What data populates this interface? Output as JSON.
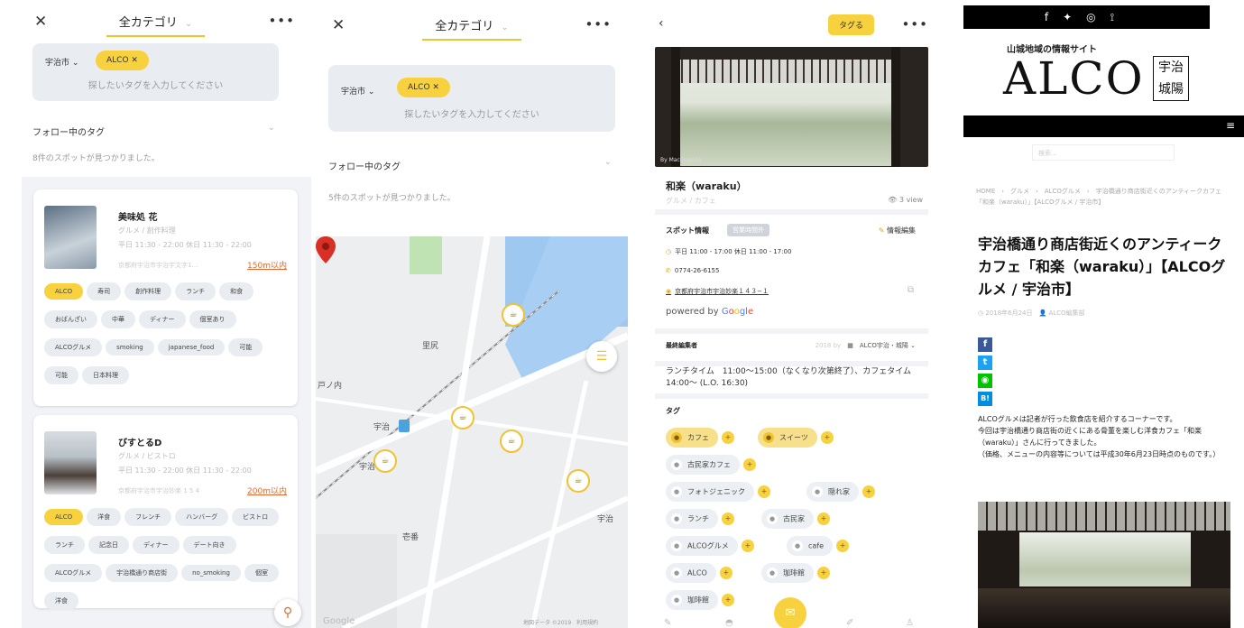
{
  "common": {
    "close": "✕",
    "menu": "•••",
    "category_title": "全カテゴリ",
    "city_filter": "宇治市 ⌄",
    "selected_tag": "ALCO ✕",
    "tag_placeholder": "探したいタグを入力してください",
    "following_tags": "フォロー中のタグ",
    "chevron": "⌄"
  },
  "list_screen": {
    "result_count": "8件のスポットが見つかりました。",
    "cards": [
      {
        "name": "美味処 花",
        "genre": "グルメ / 創作料理",
        "hours": "平日 11:30 - 22:00 休日 11:30 - 22:00",
        "address": "京都府宇治市宇治宇文字1…",
        "distance": "150m以内",
        "tags": [
          "ALCO",
          "寿司",
          "創作料理",
          "ランチ",
          "和食",
          "おばんざい",
          "中華",
          "ディナー",
          "個室あり",
          "ALCOグルメ",
          "smoking",
          "japanese_food",
          "可能",
          "可能",
          "日本料理"
        ],
        "highlight": [
          0
        ]
      },
      {
        "name": "びすとるD",
        "genre": "グルメ / ビストロ",
        "hours": "平日 11:30 - 22:00 休日 11:30 - 22:00",
        "address": "京都府宇治市宇治妙楽 1 5 4",
        "distance": "200m以内",
        "tags": [
          "ALCO",
          "洋食",
          "フレンチ",
          "ハンバーグ",
          "ビストロ",
          "ランチ",
          "記念日",
          "ディナー",
          "デート向き",
          "ALCOグルメ",
          "宇治橋通り商店街",
          "no_smoking",
          "個室",
          "洋食"
        ],
        "highlight": [
          0
        ]
      }
    ],
    "map_fab_icon": "location-pin-icon"
  },
  "map_screen": {
    "result_count": "5件のスポットが見つかりました。",
    "labels": {
      "area1": "里尻",
      "area2": "戸ノ内",
      "station": "宇治",
      "area3": "宇治",
      "area4": "壱番",
      "station_short": "宇治"
    },
    "footer": "地図データ ©2019　利用規約",
    "logo": "Google",
    "pin_glyph": "☕",
    "list_fab": "☰"
  },
  "detail_screen": {
    "back": "‹",
    "tag_button": "タグる",
    "photo_caption": "By Machiaga55",
    "name": "和楽（waraku）",
    "genre": "グルメ / カフェ",
    "views": "👁 3 view",
    "spot_info": "スポット情報",
    "info_badge": "営業時間外",
    "edit_info": "情報編集",
    "hours": "平日 11:00 - 17:00 休日 11:00 - 17:00",
    "phone": "0774-26-6155",
    "address": "京都府宇治市宇治妙楽１４３−１",
    "powered_prefix": "powered by ",
    "last_editor_label": "最終編集者",
    "editor_date": "2018 by",
    "editor_name": "ALCO宇治・城陽 ⌄",
    "lunch_text": "ランチタイム　11:00〜15:00（なくなり次第終了）、カフェタイム　14:00〜 (L.O. 16:30)",
    "tags_title": "タグ",
    "tags": [
      {
        "label": "カフェ",
        "active": true
      },
      {
        "label": "スイーツ",
        "active": true
      },
      {
        "label": "古民家カフェ",
        "active": false
      },
      {
        "label": "フォトジェニック",
        "active": false
      },
      {
        "label": "隠れ家",
        "active": false
      },
      {
        "label": "ランチ",
        "active": false
      },
      {
        "label": "古民家",
        "active": false
      },
      {
        "label": "ALCOグルメ",
        "active": false
      },
      {
        "label": "cafe",
        "active": false
      },
      {
        "label": "ALCO",
        "active": false
      },
      {
        "label": "珈琲館",
        "active": false
      },
      {
        "label": "珈琲館",
        "active": false
      }
    ],
    "chat_icon": "✉"
  },
  "blog_screen": {
    "social": "f  𝕥  ◎  ⟟",
    "site_subtitle": "山城地域の情報サイト",
    "logo": "ALCO",
    "logo_box": "宇治\n城陽",
    "menu_icon": "≡",
    "search_placeholder": "検索...",
    "breadcrumb": "HOME　›　グルメ　›　ALCOグルメ　›　宇治橋通り商店街近くのアンティークカフェ「和楽（waraku）」【ALCOグルメ / 宇治市】",
    "title": "宇治橋通り商店街近くのアンティークカフェ「和楽（waraku）」【ALCOグルメ / 宇治市】",
    "meta": "◷ 2018年6月24日　👤 ALCO編集部",
    "share": [
      "f",
      "t",
      "◉",
      "B!"
    ],
    "share_colors": [
      "#3b5998",
      "#1da1f2",
      "#00c300",
      "#008fde"
    ],
    "body": "ALCOグルメは記者が行った飲食店を紹介するコーナーです。\n今回は宇治橋通り商店街の近くにある骨董を楽しむ洋食カフェ「和楽（waraku）」さんに行ってきました。\n（価格、メニューの内容等については平成30年6月23日時点のものです。）"
  }
}
